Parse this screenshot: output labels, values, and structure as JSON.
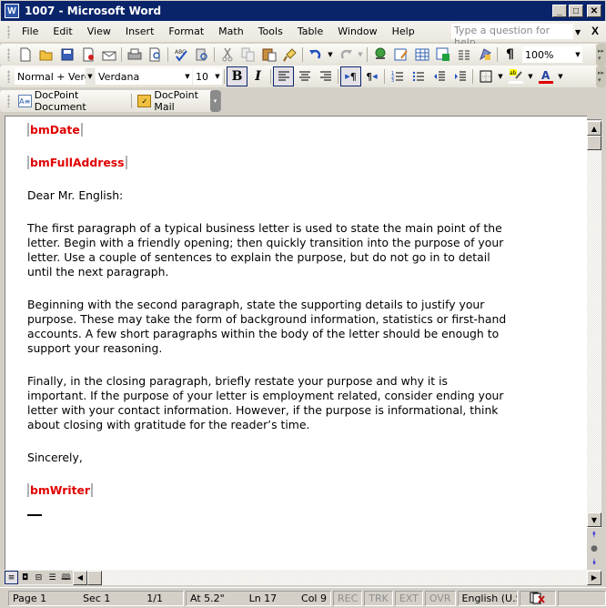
{
  "window": {
    "title": "1007 - Microsoft Word",
    "app_icon": "word-icon",
    "controls": [
      "minimize",
      "maximize",
      "close"
    ]
  },
  "menubar": {
    "items": [
      "File",
      "Edit",
      "View",
      "Insert",
      "Format",
      "Math",
      "Tools",
      "Table",
      "Window",
      "Help"
    ],
    "help_placeholder": "Type a question for help",
    "close_glyph": "X"
  },
  "standard_toolbar": {
    "buttons": [
      "new-document",
      "open",
      "save",
      "permission",
      "email",
      "print",
      "print-preview",
      "spelling-grammar",
      "research",
      "cut",
      "copy",
      "paste",
      "format-painter",
      "undo",
      "redo",
      "insert-hyperlink",
      "tables-borders",
      "insert-table",
      "insert-excel",
      "columns",
      "drawing",
      "show-hide-formatting"
    ],
    "zoom": "100%"
  },
  "formatting_toolbar": {
    "style": "Normal + Verda",
    "font": "Verdana",
    "size": "10",
    "bold_active": true,
    "align_left_active": true,
    "ltr_active": true,
    "highlight_color": "#ffff00",
    "font_color": "#e00000"
  },
  "docpoint_toolbar": {
    "items": [
      "DocPoint Document",
      "DocPoint Mail"
    ]
  },
  "document": {
    "bookmark_color": "#e00000",
    "paragraphs": [
      {
        "type": "bookmark",
        "text": "bmDate"
      },
      {
        "type": "bookmark",
        "text": "bmFullAddress"
      },
      {
        "type": "text",
        "text": "Dear Mr. English:"
      },
      {
        "type": "text",
        "text": "The first paragraph of a typical business letter is used to state the main point of the\nletter. Begin with a friendly opening; then quickly transition into the purpose of your\nletter. Use a couple of sentences to explain the purpose, but do not go in to detail\nuntil the next paragraph."
      },
      {
        "type": "text",
        "text": "Beginning with the second paragraph, state the supporting details to justify your\npurpose. These may take the form of background information, statistics or first-hand\naccounts. A few short paragraphs within the body of the letter should be enough to\nsupport your reasoning."
      },
      {
        "type": "text",
        "text": "Finally, in the closing paragraph, briefly restate your purpose and why it is\nimportant. If the purpose of your letter is employment related, consider ending your\nletter with your contact information. However, if the purpose is informational, think\nabout closing with gratitude for the reader’s time."
      },
      {
        "type": "text",
        "text": "Sincerely,"
      },
      {
        "type": "bookmark",
        "text": "bmWriter"
      }
    ]
  },
  "statusbar": {
    "page": "Page 1",
    "sec": "Sec 1",
    "pages": "1/1",
    "at": "At 5.2\"",
    "ln": "Ln 17",
    "col": "Col 9",
    "rec": "REC",
    "trk": "TRK",
    "ext": "EXT",
    "ovr": "OVR",
    "language": "English (U.S"
  }
}
